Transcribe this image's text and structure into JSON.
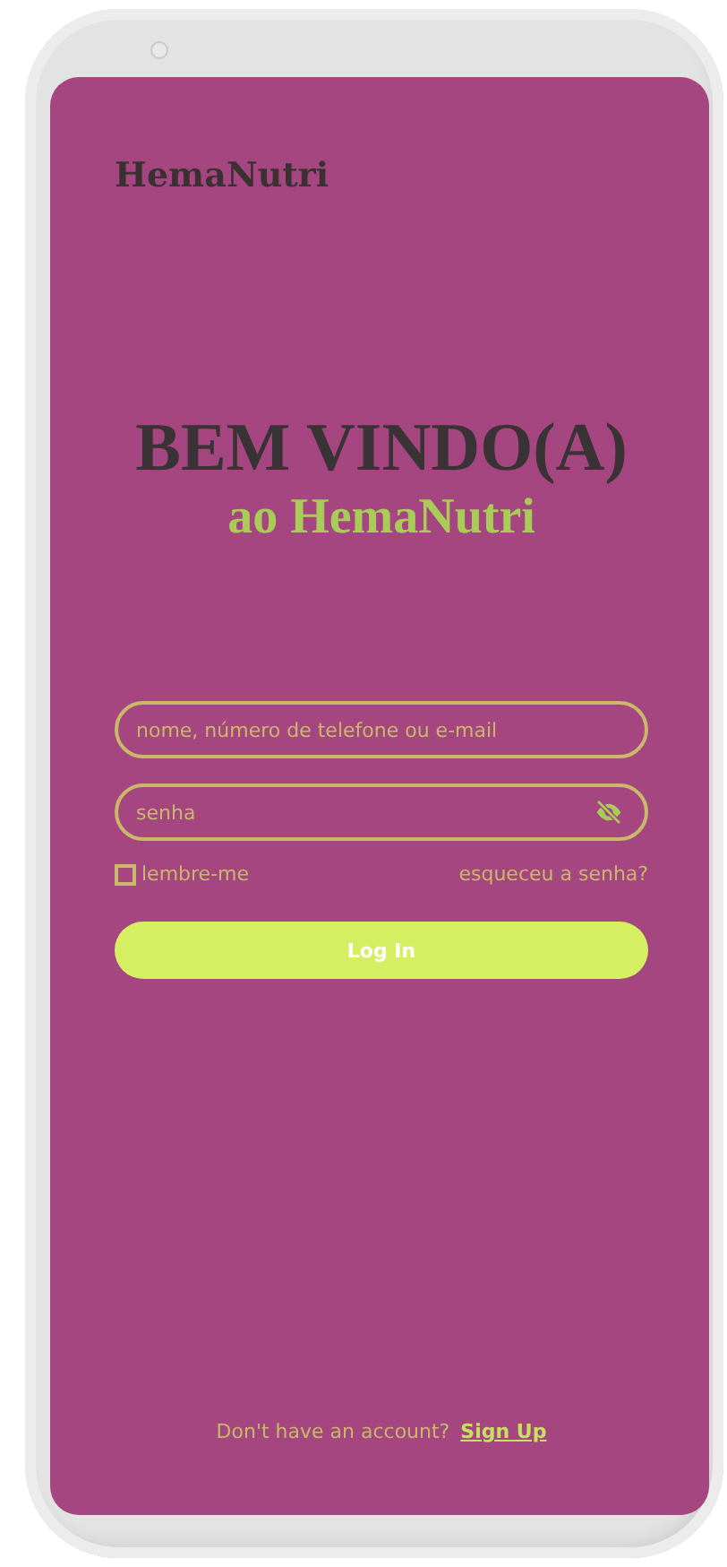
{
  "logo": "HemaNutri",
  "headline": "BEM VINDO(A)",
  "subheadline": "ao HemaNutri",
  "login_field": {
    "placeholder": "nome, número de telefone ou e-mail"
  },
  "password_field": {
    "placeholder": "senha",
    "visible": false
  },
  "remember": {
    "label": "lembre-me",
    "checked": false
  },
  "forgot_link": "esqueceu a senha?",
  "login_button": "Log In",
  "footer": {
    "text": "Don't have an account?",
    "link": "Sign Up"
  }
}
